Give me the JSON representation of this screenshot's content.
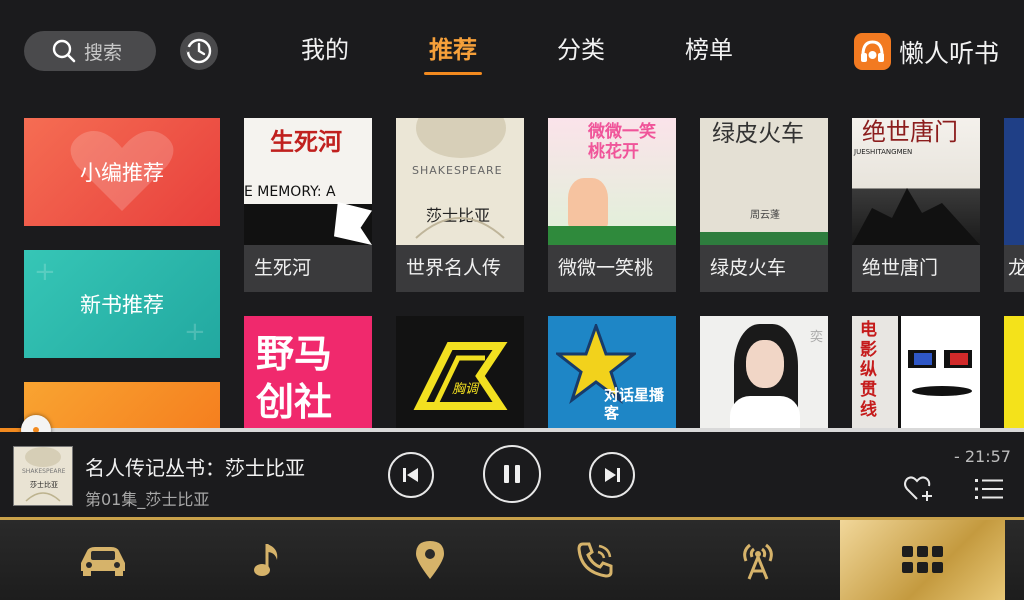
{
  "topbar": {
    "search_label": "搜索",
    "tabs": [
      {
        "label": "我的",
        "active": false
      },
      {
        "label": "推荐",
        "active": true
      },
      {
        "label": "分类",
        "active": false
      },
      {
        "label": "榜单",
        "active": false
      }
    ],
    "brand_name": "懒人听书"
  },
  "categories": [
    {
      "label": "小编推荐",
      "color": "#e8403c"
    },
    {
      "label": "新书推荐",
      "color": "#22a8a0"
    },
    {
      "label": "",
      "color": "#f57f1f"
    }
  ],
  "books_row1": [
    {
      "title": "生死河",
      "cover_text": "生死河",
      "cover_sub": "E MEMORY: A"
    },
    {
      "title": "世界名人传",
      "cover_text": "莎士比亚",
      "cover_sub": "SHAKESPEARE"
    },
    {
      "title": "微微一笑桃",
      "cover_text": "微微一笑桃花开"
    },
    {
      "title": "绿皮火车",
      "cover_text": "绿皮火车",
      "cover_sub": "周云蓬"
    },
    {
      "title": "绝世唐门",
      "cover_text": "绝世唐门",
      "cover_sub": "JUESHITANGMEN"
    },
    {
      "title": "龙"
    }
  ],
  "books_row2": [
    {
      "cover_text": "野马创社"
    },
    {
      "cover_text": "胸调"
    },
    {
      "cover_text": "对话星播客"
    },
    {
      "cover_text": "奕"
    },
    {
      "cover_text": "电影纵贯线"
    }
  ],
  "player": {
    "title": "名人传记丛书：莎士比亚",
    "episode": "第01集_莎士比亚",
    "remaining": "- 21:57",
    "progress": 0.035
  },
  "dock": [
    {
      "icon": "car-icon",
      "active": false
    },
    {
      "icon": "music-note-icon",
      "active": false
    },
    {
      "icon": "location-pin-icon",
      "active": false
    },
    {
      "icon": "phone-icon",
      "active": false
    },
    {
      "icon": "radio-tower-icon",
      "active": false
    },
    {
      "icon": "apps-grid-icon",
      "active": true
    }
  ],
  "colors": {
    "accent": "#f28a1f",
    "dock_active": "#d4b066"
  }
}
